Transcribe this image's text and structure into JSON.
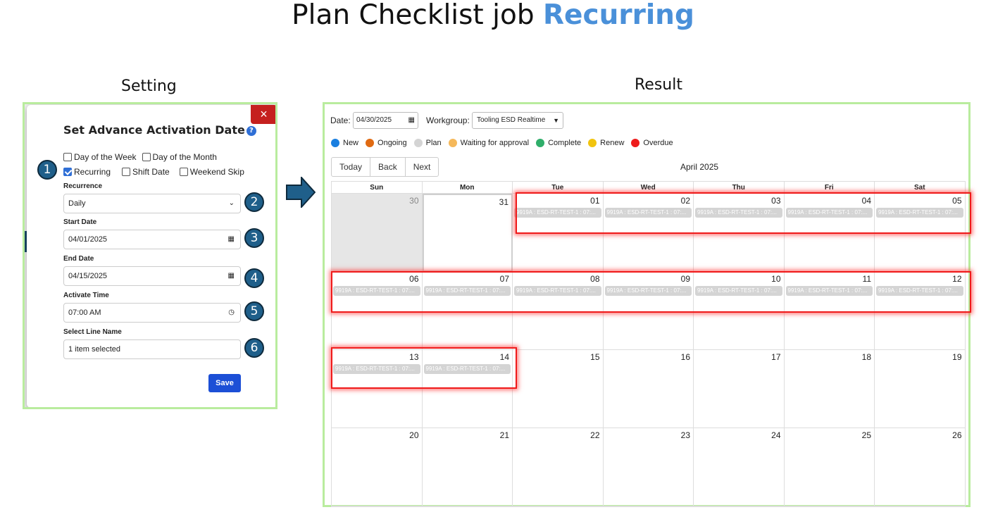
{
  "header": {
    "title_prefix": "Plan Checklist job ",
    "title_accent": "Recurring",
    "setting_label": "Setting",
    "result_label": "Result"
  },
  "colors": {
    "accent": "#4a90d9",
    "highlight": "#ef1a1a",
    "save_button": "#1c4fd6",
    "close_button": "#c5201f"
  },
  "modal": {
    "title": "Set Advance Activation Date",
    "help_icon": "question-circle-icon",
    "close_icon": "×",
    "checkboxes": [
      {
        "label": "Day of the Week",
        "checked": false
      },
      {
        "label": "Day of the Month",
        "checked": false
      },
      {
        "label": "Recurring",
        "checked": true
      },
      {
        "label": "Shift Date",
        "checked": false
      },
      {
        "label": "Weekend Skip",
        "checked": false
      }
    ],
    "recurrence_label": "Recurrence",
    "recurrence_value": "Daily",
    "start_date_label": "Start Date",
    "start_date_value": "04/01/2025",
    "end_date_label": "End Date",
    "end_date_value": "04/15/2025",
    "activate_time_label": "Activate Time",
    "activate_time_value": "07:00 AM",
    "line_name_label": "Select Line Name",
    "line_name_value": "1 item selected",
    "save_label": "Save",
    "step_numbers": [
      "1",
      "2",
      "3",
      "4",
      "5",
      "6"
    ]
  },
  "result": {
    "date_label": "Date:",
    "date_value": "04/30/2025",
    "workgroup_label": "Workgroup:",
    "workgroup_value": "Tooling ESD Realtime",
    "legend": [
      {
        "label": "New",
        "color": "#1a7fe0"
      },
      {
        "label": "Ongoing",
        "color": "#e06a12"
      },
      {
        "label": "Plan",
        "color": "#d4d4d4"
      },
      {
        "label": "Waiting for approval",
        "color": "#f5b85a"
      },
      {
        "label": "Complete",
        "color": "#2fae6a"
      },
      {
        "label": "Renew",
        "color": "#f1c40f"
      },
      {
        "label": "Overdue",
        "color": "#ee1c1c"
      }
    ],
    "nav": [
      "Today",
      "Back",
      "Next"
    ],
    "month": "April 2025",
    "weekdays": [
      "Sun",
      "Mon",
      "Tue",
      "Wed",
      "Thu",
      "Fri",
      "Sat"
    ],
    "weeks": [
      [
        "30",
        "31",
        "01",
        "02",
        "03",
        "04",
        "05"
      ],
      [
        "06",
        "07",
        "08",
        "09",
        "10",
        "11",
        "12"
      ],
      [
        "13",
        "14",
        "15",
        "16",
        "17",
        "18",
        "19"
      ],
      [
        "20",
        "21",
        "22",
        "23",
        "24",
        "25",
        "26"
      ]
    ],
    "event_text": "9919A : ESD-RT-TEST-1 : 07:..."
  }
}
